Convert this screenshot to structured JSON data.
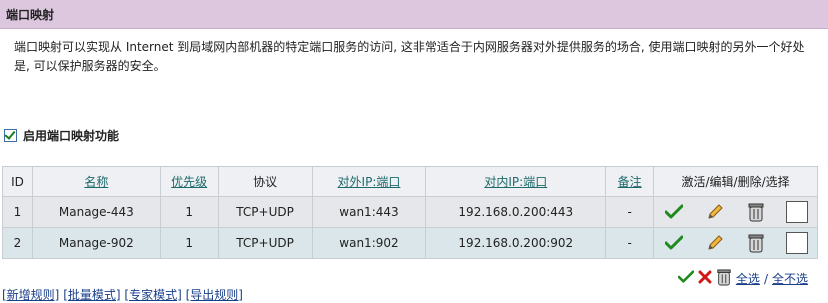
{
  "page": {
    "title": "端口映射",
    "description": "端口映射可以实现从 Internet 到局域网内部机器的特定端口服务的访问, 这非常适合于内网服务器对外提供服务的场合, 使用端口映射的另外一个好处是, 可以保护服务器的安全。"
  },
  "enable": {
    "label": "启用端口映射功能",
    "checked": true
  },
  "table": {
    "headers": [
      "ID",
      "名称",
      "优先级",
      "协议",
      "对外IP:端口",
      "对内IP:端口",
      "备注",
      "激活/编辑/删除/选择"
    ],
    "rows": [
      {
        "id": "1",
        "name": "Manage-443",
        "priority": "1",
        "protocol": "TCP+UDP",
        "external": "wan1:443",
        "internal": "192.168.0.200:443",
        "note": "-"
      },
      {
        "id": "2",
        "name": "Manage-902",
        "priority": "1",
        "protocol": "TCP+UDP",
        "external": "wan1:902",
        "internal": "192.168.0.200:902",
        "note": "-"
      }
    ]
  },
  "actions": {
    "select_all": "全选",
    "separator": "/",
    "select_none": "全不选"
  },
  "bottom_links": [
    "[新增规则]",
    "[批量模式]",
    "[专家模式]",
    "[导出规则]"
  ]
}
